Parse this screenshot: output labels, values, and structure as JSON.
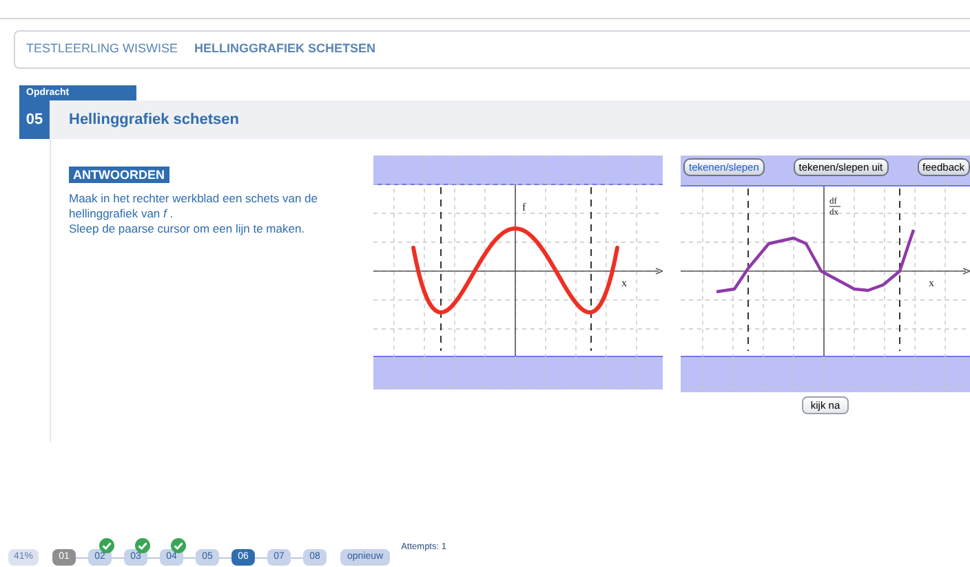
{
  "breadcrumb": [
    {
      "label": "TESTLEERLING WISWISE",
      "bold": false
    },
    {
      "label": "HELLINGGRAFIEK SCHETSEN",
      "bold": true
    }
  ],
  "assignment": {
    "label": "Opdracht",
    "number": "05",
    "title": "Hellinggrafiek schetsen"
  },
  "answers": {
    "heading": "ANTWOORDEN",
    "instructions": [
      "Maak in het rechter werkblad een schets van de hellinggrafiek van  *f* .",
      "Sleep de paarse cursor om een lijn te maken."
    ]
  },
  "graph_f": {
    "y_label": "f",
    "x_label": "x"
  },
  "graph_slope": {
    "y_label_top": "df",
    "y_label_bottom": "dx",
    "x_label": "x",
    "tools": [
      {
        "label": "tekenen/slepen",
        "selected": true
      },
      {
        "label": "tekenen/slepen uit",
        "selected": false
      },
      {
        "label": "feedback",
        "selected": false
      }
    ],
    "check_button": "kijk na"
  },
  "footer": {
    "score": "41%",
    "steps": [
      {
        "label": "01",
        "checked": false,
        "selected": false,
        "disabled": true
      },
      {
        "label": "02",
        "checked": true,
        "selected": false,
        "disabled": false
      },
      {
        "label": "03",
        "checked": true,
        "selected": false,
        "disabled": false
      },
      {
        "label": "04",
        "checked": true,
        "selected": false,
        "disabled": false
      },
      {
        "label": "05",
        "checked": false,
        "selected": false,
        "disabled": false
      },
      {
        "label": "06",
        "checked": false,
        "selected": true,
        "disabled": false
      },
      {
        "label": "07",
        "checked": false,
        "selected": false,
        "disabled": false
      },
      {
        "label": "08",
        "checked": false,
        "selected": false,
        "disabled": false
      }
    ],
    "retry_button": "opnieuw",
    "attempts": "Attempts: 1"
  }
}
